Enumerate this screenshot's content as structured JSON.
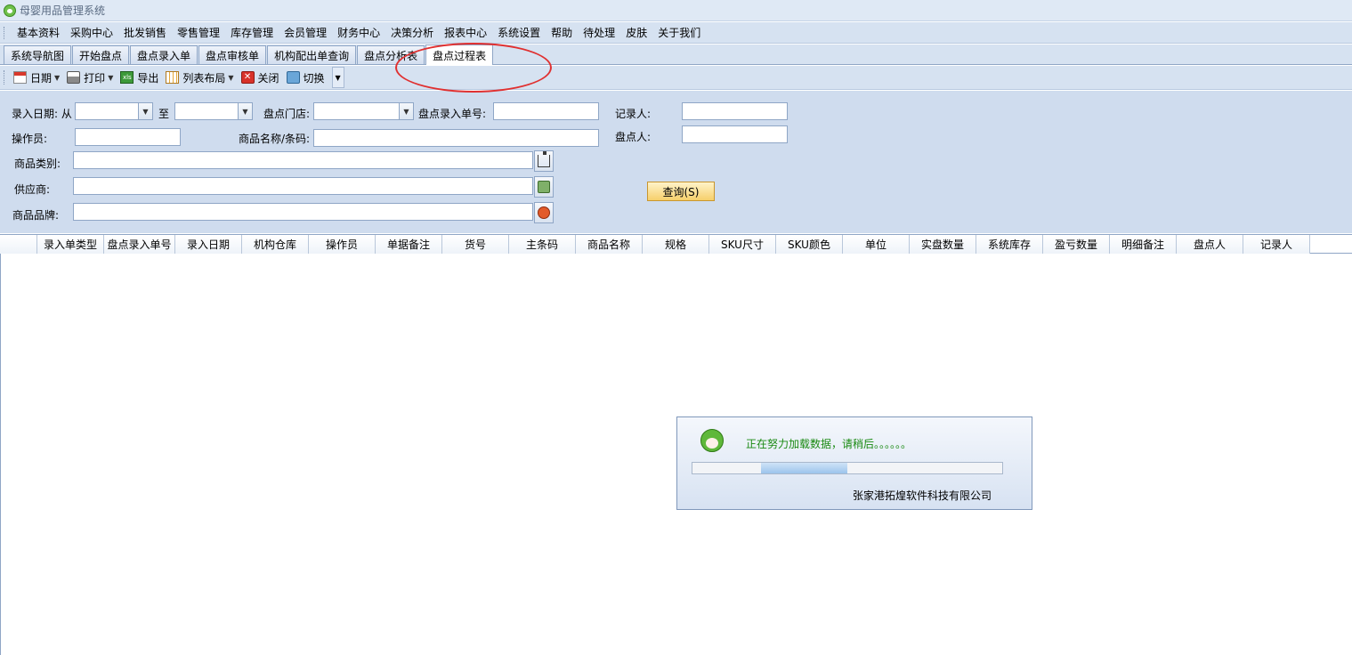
{
  "window": {
    "title": "母婴用品管理系统"
  },
  "menu": [
    "基本资料",
    "采购中心",
    "批发销售",
    "零售管理",
    "库存管理",
    "会员管理",
    "财务中心",
    "决策分析",
    "报表中心",
    "系统设置",
    "帮助",
    "待处理",
    "皮肤",
    "关于我们"
  ],
  "tabs": [
    {
      "label": "系统导航图",
      "active": false
    },
    {
      "label": "开始盘点",
      "active": false
    },
    {
      "label": "盘点录入单",
      "active": false
    },
    {
      "label": "盘点审核单",
      "active": false
    },
    {
      "label": "机构配出单查询",
      "active": false
    },
    {
      "label": "盘点分析表",
      "active": false
    },
    {
      "label": "盘点过程表",
      "active": true
    }
  ],
  "toolbar": {
    "date": "日期",
    "print": "打印",
    "export": "导出",
    "export_icon_text": "xls",
    "layout": "列表布局",
    "close": "关闭",
    "close_icon_text": "✕",
    "switch": "切换"
  },
  "filters": {
    "date_from_label": "录入日期: 从",
    "date_to_label": "至",
    "store_label": "盘点门店:",
    "entry_no_label": "盘点录入单号:",
    "recorder_label": "记录人:",
    "operator_label": "操作员:",
    "product_name_label": "商品名称/条码:",
    "counter_label": "盘点人:",
    "category_label": "商品类别:",
    "supplier_label": "供应商:",
    "brand_label": "商品品牌:",
    "query_button": "查询(S)",
    "date_from_value": "",
    "date_to_value": "",
    "store_value": "",
    "entry_no_value": "",
    "recorder_value": "",
    "operator_value": "",
    "product_name_value": "",
    "counter_value": "",
    "category_value": "",
    "supplier_value": "",
    "brand_value": ""
  },
  "grid": {
    "columns": [
      "",
      "录入单类型",
      "盘点录入单号",
      "录入日期",
      "机构仓库",
      "操作员",
      "单据备注",
      "货号",
      "主条码",
      "商品名称",
      "规格",
      "SKU尺寸",
      "SKU颜色",
      "单位",
      "实盘数量",
      "系统库存",
      "盈亏数量",
      "明细备注",
      "盘点人",
      "记录人"
    ],
    "rows": []
  },
  "loading": {
    "message": "正在努力加载数据，请稍后。。。。。。",
    "company": "张家港拓煌软件科技有限公司",
    "progress_start": 0.22,
    "progress_end": 0.5
  },
  "colors": {
    "annotation": "#e03030",
    "loading_text": "#1a8a12",
    "query_button": "#f6cf6b"
  },
  "icons": {
    "app": "app-logo-icon",
    "date": "calendar-icon",
    "print": "printer-icon",
    "export": "excel-icon",
    "layout": "table-layout-icon",
    "close": "close-icon",
    "switch": "switch-icon",
    "category_pick": "tree-icon",
    "supplier_pick": "supplier-icon",
    "brand_pick": "brand-icon"
  }
}
